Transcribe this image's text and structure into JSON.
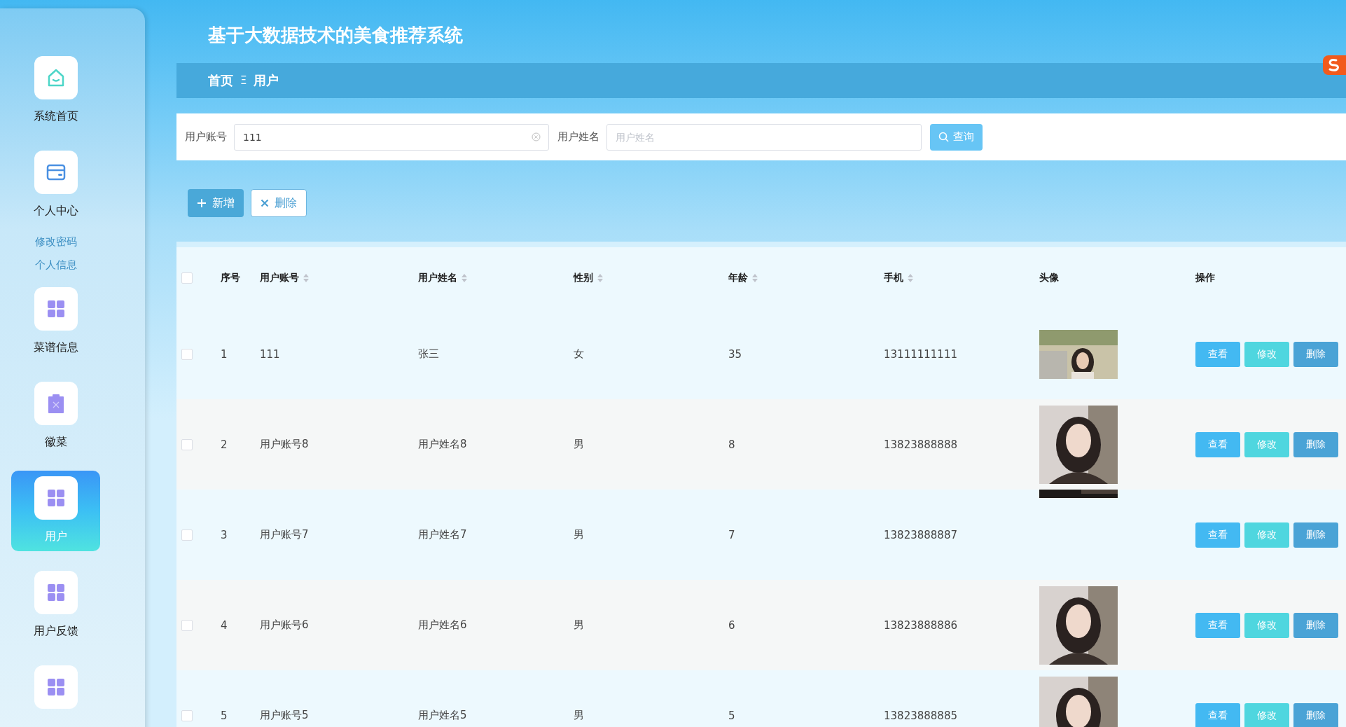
{
  "app_title": "基于大数据技术的美食推荐系统",
  "breadcrumb": {
    "home": "首页",
    "separator": "Ξ",
    "current": "用户"
  },
  "sidebar": {
    "items": [
      {
        "label": "系统首页",
        "kind": "home",
        "selected": false
      },
      {
        "label": "个人中心",
        "kind": "card",
        "selected": false,
        "children": [
          {
            "label": "修改密码"
          },
          {
            "label": "个人信息"
          }
        ]
      },
      {
        "label": "菜谱信息",
        "kind": "grid",
        "selected": false
      },
      {
        "label": "徽菜",
        "kind": "clipboard",
        "selected": false
      },
      {
        "label": "用户",
        "kind": "grid",
        "selected": true
      },
      {
        "label": "用户反馈",
        "kind": "grid",
        "selected": false
      },
      {
        "kind": "grid",
        "selected": false
      }
    ]
  },
  "search": {
    "fields": [
      {
        "label": "用户账号",
        "value": "111"
      },
      {
        "label": "用户姓名",
        "placeholder": "用户姓名"
      }
    ],
    "button": "查询"
  },
  "actions": [
    {
      "kind": "add",
      "label": "新增"
    },
    {
      "kind": "delete",
      "label": "删除"
    }
  ],
  "table": {
    "all_checked": false,
    "columns": [
      {
        "label": "序号",
        "sortable": false
      },
      {
        "label": "用户账号",
        "sortable": true
      },
      {
        "label": "用户姓名",
        "sortable": true
      },
      {
        "label": "性别",
        "sortable": true
      },
      {
        "label": "年龄",
        "sortable": true
      },
      {
        "label": "手机",
        "sortable": true
      },
      {
        "label": "头像",
        "sortable": false
      },
      {
        "label": "操作",
        "sortable": false
      }
    ],
    "rows": [
      {
        "checked": false,
        "index": "1",
        "account": "111",
        "name": "张三",
        "gender": "女",
        "age": "35",
        "phone": "13111111111",
        "actions": [
          "查看",
          "修改",
          "删除"
        ]
      },
      {
        "checked": false,
        "index": "2",
        "account": "用户账号8",
        "name": "用户姓名8",
        "gender": "男",
        "age": "8",
        "phone": "13823888888",
        "actions": [
          "查看",
          "修改",
          "删除"
        ]
      },
      {
        "checked": false,
        "index": "3",
        "account": "用户账号7",
        "name": "用户姓名7",
        "gender": "男",
        "age": "7",
        "phone": "13823888887",
        "actions": [
          "查看",
          "修改",
          "删除"
        ]
      },
      {
        "checked": false,
        "index": "4",
        "account": "用户账号6",
        "name": "用户姓名6",
        "gender": "男",
        "age": "6",
        "phone": "13823888886",
        "actions": [
          "查看",
          "修改",
          "删除"
        ]
      },
      {
        "checked": false,
        "index": "5",
        "account": "用户账号5",
        "name": "用户姓名5",
        "gender": "男",
        "age": "5",
        "phone": "13823888885",
        "actions": [
          "查看",
          "修改",
          "删除"
        ]
      }
    ]
  }
}
